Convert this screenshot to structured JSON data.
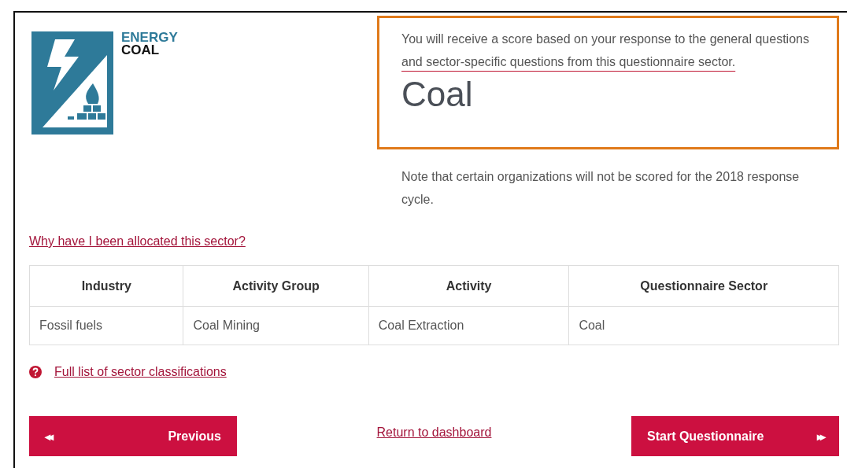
{
  "logo": {
    "category": "ENERGY",
    "sector": "COAL"
  },
  "score_box": {
    "intro": "You will receive a score based on your response to the general questions ",
    "underlined": "and sector-specific questions from this questionnaire sector.",
    "sector": "Coal"
  },
  "note": "Note that certain organizations will not be scored for the 2018 response cycle.",
  "allocation_link": "Why have I been allocated this sector?",
  "table": {
    "columns": [
      "Industry",
      "Activity Group",
      "Activity",
      "Questionnaire Sector"
    ],
    "rows": [
      [
        "Fossil fuels",
        "Coal Mining",
        "Coal Extraction",
        "Coal"
      ]
    ]
  },
  "help_link": "Full list of sector classifications",
  "footer": {
    "previous": {
      "label": "Previous",
      "icon": "◂◂"
    },
    "dashboard_link": "Return to dashboard",
    "start": {
      "label": "Start Questionnaire",
      "icon": "▸▸"
    }
  }
}
